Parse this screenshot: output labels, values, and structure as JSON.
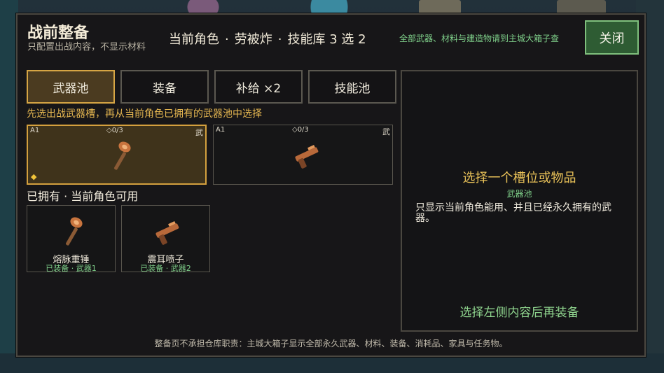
{
  "title": "战前整备",
  "subtitle": "只配置出战内容，不显示材料",
  "header": {
    "role_label": "当前角色",
    "dot": "·",
    "role_name": "劳被炸",
    "skill_pool": "技能库 3 选 2",
    "note": "全部武器、材料与建造物请到主城大箱子查",
    "close_label": "关闭"
  },
  "tabs": [
    {
      "label": "武器池",
      "active": true
    },
    {
      "label": "装备",
      "active": false
    },
    {
      "label": "补给 ×2",
      "active": false
    },
    {
      "label": "技能池",
      "active": false
    }
  ],
  "hint": "先选出战武器槽，再从当前角色已拥有的武器池中选择",
  "slots": [
    {
      "id": "A1",
      "count": "◇0/3",
      "type": "武",
      "marker": "◆",
      "icon": "hammer-icon"
    },
    {
      "id": "A1",
      "count": "◇0/3",
      "type": "武",
      "icon": "gun-icon"
    }
  ],
  "owned": {
    "title": "已拥有 · 当前角色可用",
    "items": [
      {
        "name": "熔脉重锤",
        "state": "已装备 · 武器1",
        "icon": "hammer-icon"
      },
      {
        "name": "震耳喷子",
        "state": "已装备 · 武器2",
        "icon": "gun-icon"
      }
    ]
  },
  "detail": {
    "prompt": "选择一个槽位或物品",
    "category": "武器池",
    "description": "只显示当前角色能用、并且已经永久拥有的武器。",
    "action": "选择左侧内容后再装备"
  },
  "footer": "整备页不承担仓库职责：主城大箱子显示全部永久武器、材料、装备、消耗品、家具与任务物。",
  "colors": {
    "accent_gold": "#d4a03e",
    "accent_green": "#7fd08a",
    "close_bg": "#2e5c33",
    "panel_bg": "#171618"
  }
}
